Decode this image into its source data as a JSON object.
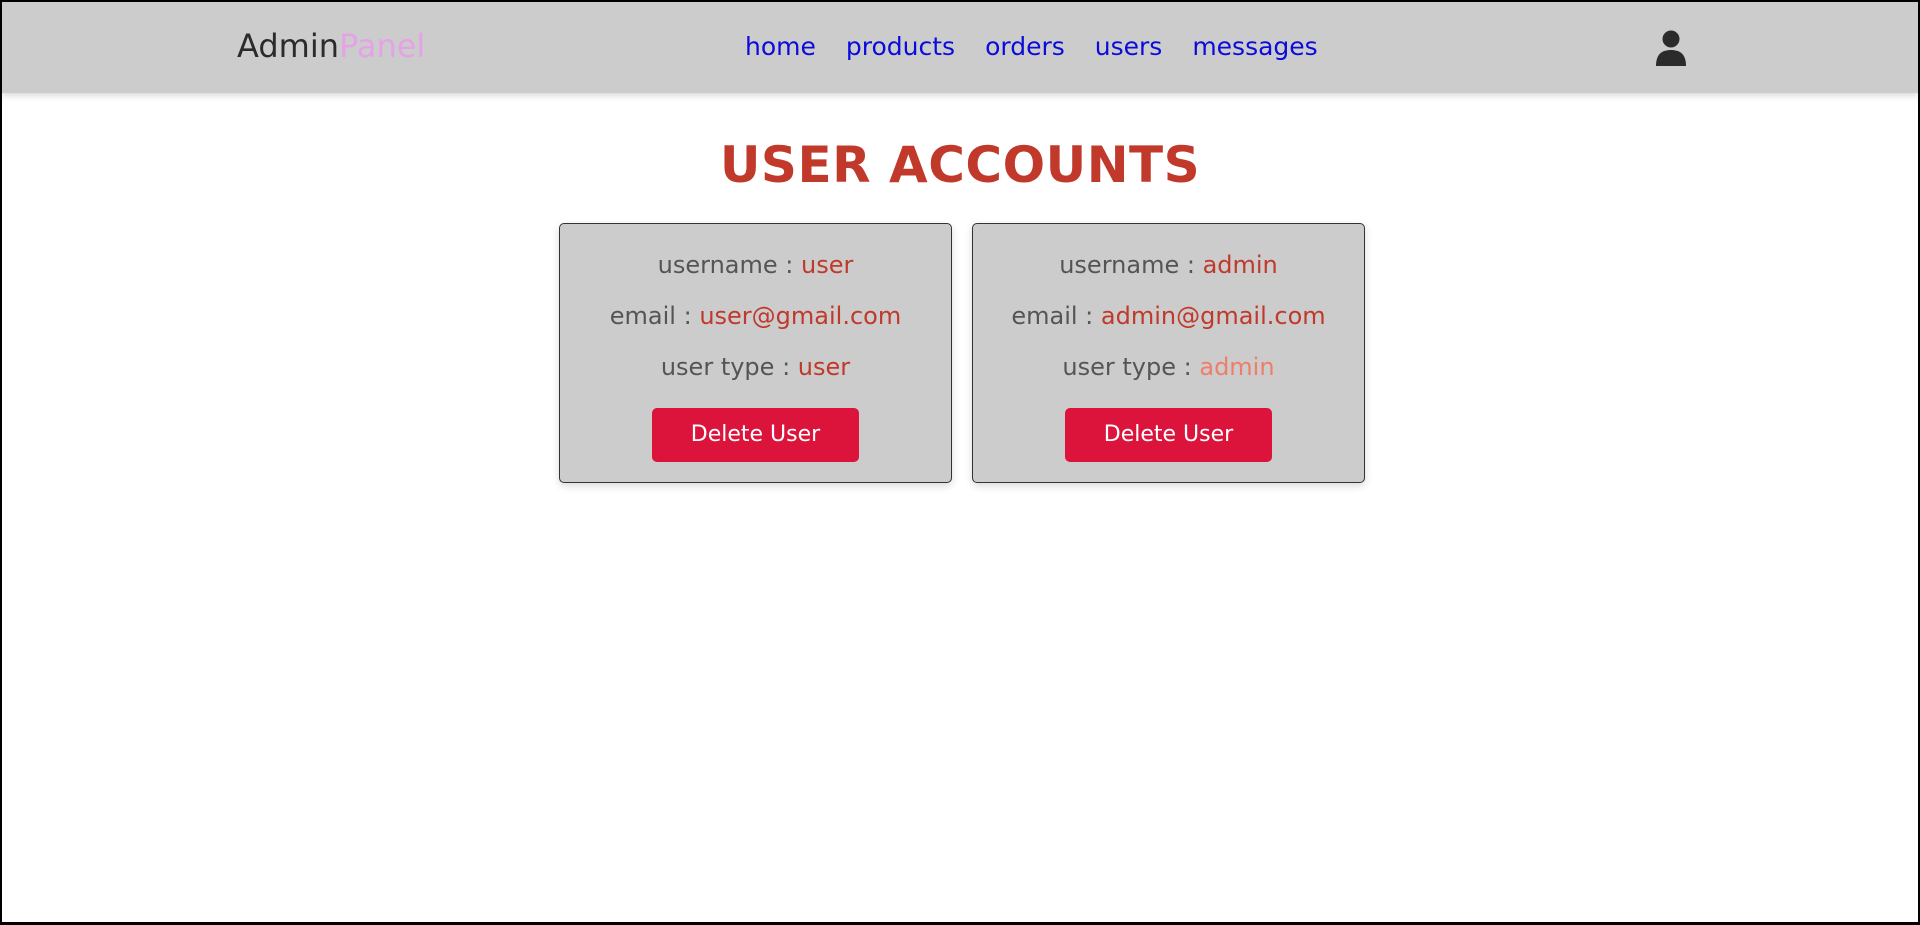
{
  "header": {
    "logo_main": "Admin",
    "logo_accent": "Panel",
    "nav": [
      {
        "label": "home"
      },
      {
        "label": "products"
      },
      {
        "label": "orders"
      },
      {
        "label": "users"
      },
      {
        "label": "messages"
      }
    ],
    "user_icon": "user-icon"
  },
  "page": {
    "title": "USER ACCOUNTS"
  },
  "labels": {
    "username": "username : ",
    "email": "email : ",
    "user_type": "user type : "
  },
  "users": [
    {
      "username": "user",
      "email": "user@gmail.com",
      "user_type": "user",
      "delete_label": "Delete User"
    },
    {
      "username": "admin",
      "email": "admin@gmail.com",
      "user_type": "admin",
      "delete_label": "Delete User"
    }
  ],
  "colors": {
    "header_bg": "#cccccc",
    "nav_link": "#0b0bdc",
    "logo_accent": "#e4a3e6",
    "title": "#c0392b",
    "value": "#c0392b",
    "admin_type": "#f07d6a",
    "delete_button": "#dc143c"
  }
}
